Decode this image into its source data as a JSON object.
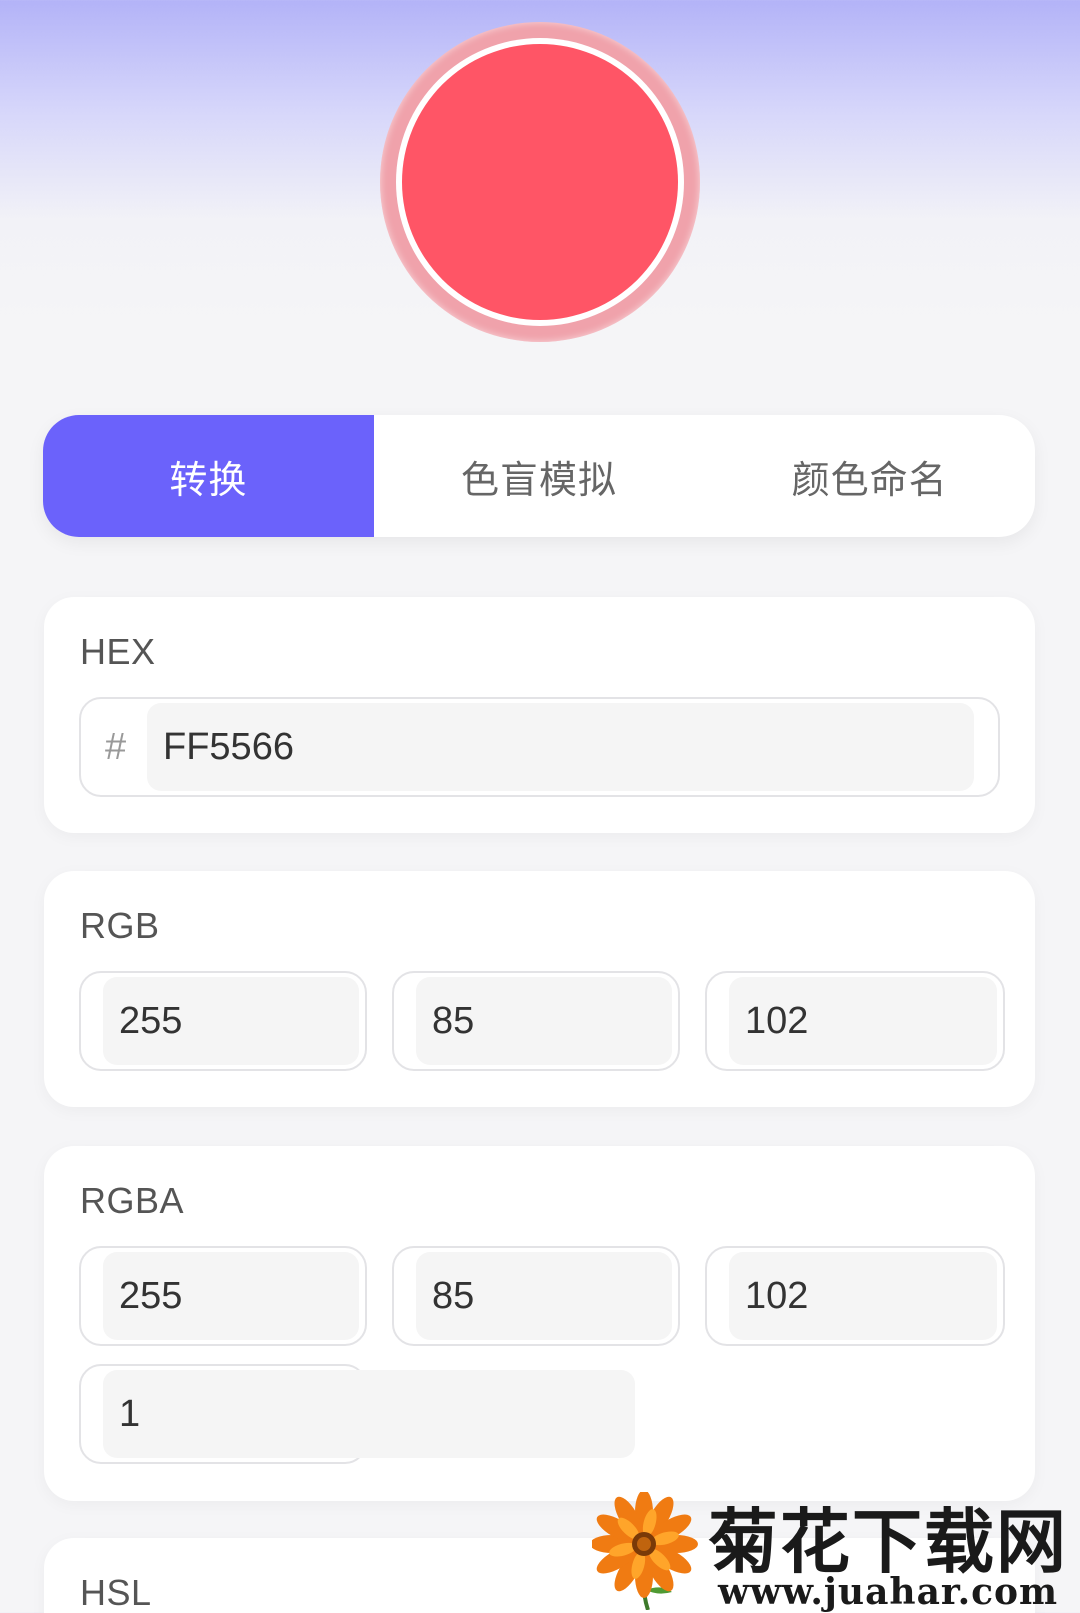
{
  "colors": {
    "current": "#FF5566",
    "accent": "#6B62FB"
  },
  "tabs": [
    {
      "label": "转换",
      "active": true
    },
    {
      "label": "色盲模拟",
      "active": false
    },
    {
      "label": "颜色命名",
      "active": false
    }
  ],
  "hex": {
    "title": "HEX",
    "prefix": "#",
    "value": "FF5566"
  },
  "rgb": {
    "title": "RGB",
    "r": "255",
    "g": "85",
    "b": "102"
  },
  "rgba": {
    "title": "RGBA",
    "r": "255",
    "g": "85",
    "b": "102",
    "a": "1"
  },
  "hsl": {
    "title": "HSL"
  },
  "watermark": {
    "title": "菊花下载网",
    "url": "www.juahar.com",
    "icon": "flower-icon"
  }
}
